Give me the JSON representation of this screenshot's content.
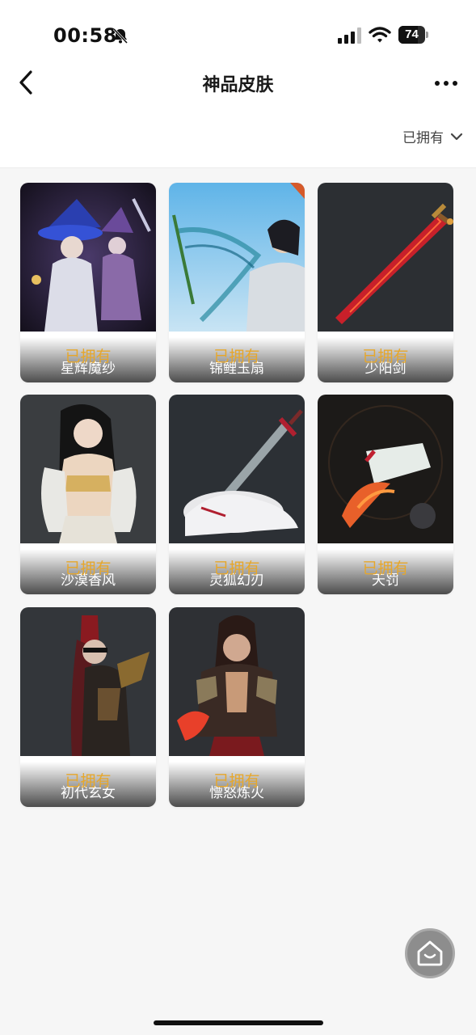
{
  "status": {
    "time": "00:58",
    "battery": "74",
    "battery_level": 0.74,
    "icons": [
      "bell-muted-icon",
      "signal-icon",
      "wifi-icon",
      "battery-icon"
    ]
  },
  "nav": {
    "title": "神品皮肤",
    "back_icon": "chevron-left-icon",
    "more_icon": "more-dots-icon"
  },
  "filter": {
    "label": "已拥有",
    "icon": "chevron-down-icon"
  },
  "colors": {
    "owned_text": "#e6a72c",
    "background": "#f6f6f6"
  },
  "skins": [
    {
      "name": "星辉魔纱",
      "status": "已拥有"
    },
    {
      "name": "锦鲤玉扇",
      "status": "已拥有"
    },
    {
      "name": "少阳剑",
      "status": "已拥有"
    },
    {
      "name": "沙漠香风",
      "status": "已拥有"
    },
    {
      "name": "灵狐幻刃",
      "status": "已拥有"
    },
    {
      "name": "天罚",
      "status": "已拥有"
    },
    {
      "name": "初代玄女",
      "status": "已拥有"
    },
    {
      "name": "慓怒炼火",
      "status": "已拥有"
    }
  ],
  "fab": {
    "icon": "home-icon"
  }
}
